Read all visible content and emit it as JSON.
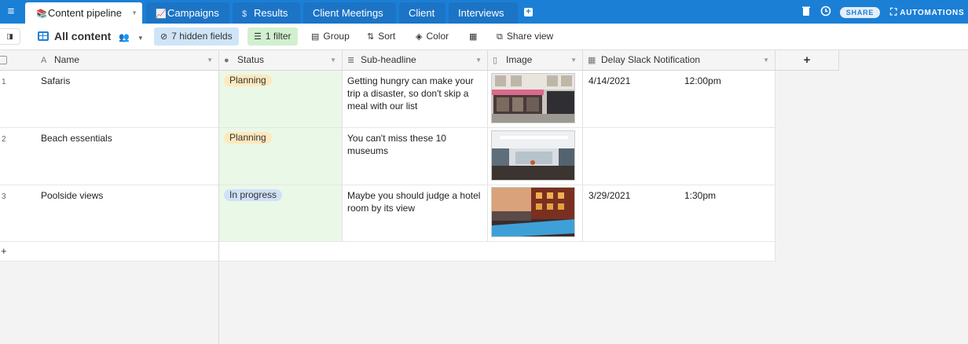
{
  "tabs": [
    {
      "label": "Content pipeline",
      "icon": "books-icon",
      "active": true
    },
    {
      "label": "Campaigns",
      "icon": "chart-icon"
    },
    {
      "label": "Results",
      "icon": "dollar-icon"
    },
    {
      "label": "Client Meetings"
    },
    {
      "label": "Client"
    },
    {
      "label": "Interviews"
    }
  ],
  "topbar": {
    "share": "SHARE",
    "automations": "AUTOMATIONS"
  },
  "toolbar": {
    "view_name": "All content",
    "hidden_fields": "7 hidden fields",
    "filter": "1 filter",
    "group": "Group",
    "sort": "Sort",
    "color": "Color",
    "share_view": "Share view"
  },
  "columns": {
    "name": "Name",
    "status": "Status",
    "subheadline": "Sub-headline",
    "image": "Image",
    "delay": "Delay Slack Notification"
  },
  "rows": [
    {
      "num": "1",
      "name": "Safaris",
      "status": "Planning",
      "subheadline": "Getting hungry can make your trip a disaster, so don't skip a meal with our list",
      "date": "4/14/2021",
      "time": "12:00pm"
    },
    {
      "num": "2",
      "name": "Beach essentials",
      "status": "Planning",
      "subheadline": "You can't miss these 10 museums",
      "date": "",
      "time": ""
    },
    {
      "num": "3",
      "name": "Poolside views",
      "status": "In progress",
      "subheadline": "Maybe you should judge a hotel room by its view",
      "date": "3/29/2021",
      "time": "1:30pm"
    }
  ],
  "colors": {
    "accent": "#1b7fd6",
    "planning": "#fde9bd",
    "in_progress": "#cfe0f8",
    "status_col": "#eaf8e8"
  }
}
